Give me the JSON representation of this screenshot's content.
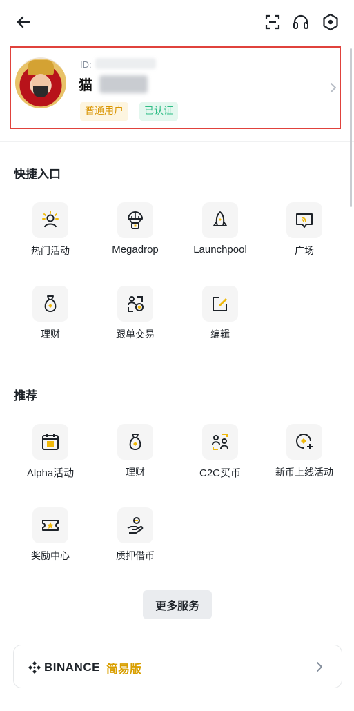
{
  "header": {
    "back_icon": "arrow-left-icon",
    "scan_icon": "scan-icon",
    "support_icon": "headset-icon",
    "settings_icon": "hex-settings-icon"
  },
  "profile": {
    "id_label": "ID:",
    "nickname": "猫",
    "badge_user_level": "普通用户",
    "badge_verified": "已认证"
  },
  "quick_access": {
    "title": "快捷入口",
    "items": [
      {
        "label": "热门活动",
        "icon": "hot-activity-icon"
      },
      {
        "label": "Megadrop",
        "icon": "parachute-icon"
      },
      {
        "label": "Launchpool",
        "icon": "rocket-icon"
      },
      {
        "label": "广场",
        "icon": "square-feed-icon"
      },
      {
        "label": "理财",
        "icon": "money-bag-icon"
      },
      {
        "label": "跟单交易",
        "icon": "copy-trading-icon"
      },
      {
        "label": "编辑",
        "icon": "edit-icon"
      }
    ]
  },
  "recommended": {
    "title": "推荐",
    "items": [
      {
        "label": "Alpha活动",
        "icon": "alpha-calendar-icon"
      },
      {
        "label": "理财",
        "icon": "money-bag-icon"
      },
      {
        "label": "C2C买币",
        "icon": "c2c-icon"
      },
      {
        "label": "新币上线活动",
        "icon": "new-listing-icon"
      },
      {
        "label": "奖励中心",
        "icon": "reward-ticket-icon"
      },
      {
        "label": "质押借币",
        "icon": "loan-icon"
      }
    ]
  },
  "more_services_label": "更多服务",
  "lite_banner": {
    "brand": "BINANCE",
    "mode": "简易版"
  },
  "colors": {
    "accent": "#f0b90b",
    "text": "#1e2329",
    "muted": "#848e9c",
    "verified": "#2ebd85",
    "highlight_border": "#e0423c"
  }
}
